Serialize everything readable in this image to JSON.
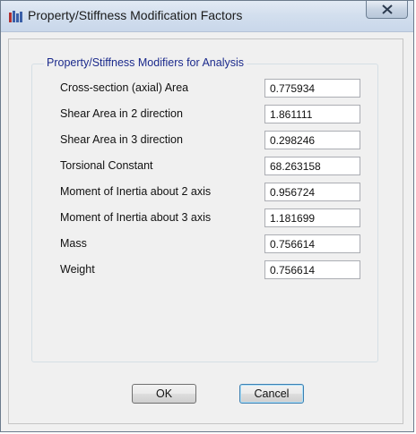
{
  "window": {
    "title": "Property/Stiffness Modification Factors"
  },
  "group": {
    "title": "Property/Stiffness Modifiers for Analysis"
  },
  "rows": [
    {
      "label": "Cross-section (axial) Area",
      "value": "0.775934"
    },
    {
      "label": "Shear Area in 2 direction",
      "value": "1.861111"
    },
    {
      "label": "Shear Area in 3 direction",
      "value": "0.298246"
    },
    {
      "label": "Torsional Constant",
      "value": "68.263158"
    },
    {
      "label": "Moment of Inertia about 2 axis",
      "value": "0.956724"
    },
    {
      "label": "Moment of Inertia about 3 axis",
      "value": "1.181699"
    },
    {
      "label": "Mass",
      "value": "0.756614"
    },
    {
      "label": "Weight",
      "value": "0.756614"
    }
  ],
  "buttons": {
    "ok": "OK",
    "cancel": "Cancel"
  },
  "icons": {
    "app": "app-icon",
    "close": "close-icon"
  }
}
